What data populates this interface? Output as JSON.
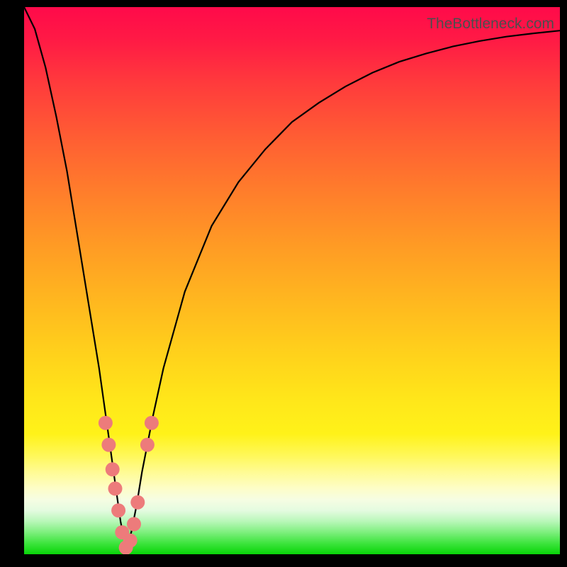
{
  "attribution": "TheBottleneck.com",
  "chart_data": {
    "type": "line",
    "title": "",
    "xlabel": "",
    "ylabel": "",
    "xlim": [
      0,
      100
    ],
    "ylim": [
      0,
      100
    ],
    "grid": false,
    "legend": false,
    "series": [
      {
        "name": "bottleneck-curve",
        "description": "V-shaped bottleneck curve; minimum near x≈19 at y≈0, rising steeply on both sides",
        "x": [
          0,
          2,
          4,
          6,
          8,
          10,
          12,
          14,
          16,
          17,
          18,
          19,
          20,
          21,
          22,
          24,
          26,
          30,
          35,
          40,
          45,
          50,
          55,
          60,
          65,
          70,
          75,
          80,
          85,
          90,
          95,
          100
        ],
        "values": [
          100,
          96,
          89,
          80,
          70,
          58,
          46,
          34,
          20,
          13,
          6,
          1,
          4,
          9,
          15,
          25,
          34,
          48,
          60,
          68,
          74,
          79,
          82.5,
          85.5,
          88,
          90,
          91.5,
          92.8,
          93.8,
          94.6,
          95.2,
          95.7
        ]
      }
    ],
    "markers": {
      "name": "highlighted-points",
      "color": "#ed7b7b",
      "points": [
        {
          "x": 15.2,
          "y": 24
        },
        {
          "x": 15.8,
          "y": 20
        },
        {
          "x": 16.5,
          "y": 15.5
        },
        {
          "x": 17.0,
          "y": 12
        },
        {
          "x": 17.6,
          "y": 8
        },
        {
          "x": 18.3,
          "y": 4
        },
        {
          "x": 19.0,
          "y": 1.2
        },
        {
          "x": 19.8,
          "y": 2.5
        },
        {
          "x": 20.5,
          "y": 5.5
        },
        {
          "x": 21.2,
          "y": 9.5
        },
        {
          "x": 23.0,
          "y": 20
        },
        {
          "x": 23.8,
          "y": 24
        }
      ]
    },
    "gradient_stops": [
      {
        "pos": 0,
        "color": "#ff0a4a"
      },
      {
        "pos": 50,
        "color": "#ffb81f"
      },
      {
        "pos": 80,
        "color": "#fff85a"
      },
      {
        "pos": 100,
        "color": "#08d408"
      }
    ]
  }
}
